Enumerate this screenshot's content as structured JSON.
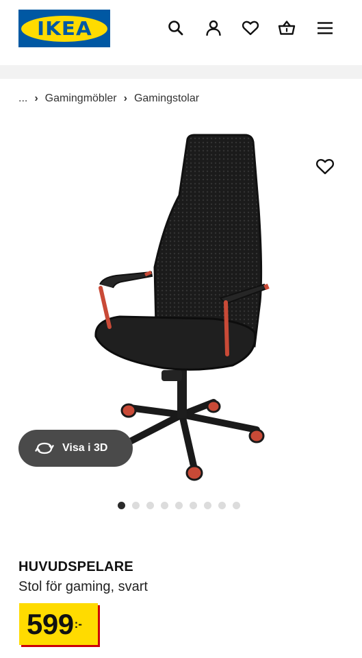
{
  "header": {
    "logo_text": "IKEA",
    "icons": [
      "search-icon",
      "account-icon",
      "heart-icon",
      "basket-icon",
      "menu-icon"
    ]
  },
  "breadcrumb": {
    "ellipsis": "...",
    "items": [
      "Gamingmöbler",
      "Gamingstolar"
    ]
  },
  "gallery": {
    "view_3d_label": "Visa i 3D",
    "image_count": 9,
    "active_index": 0
  },
  "product": {
    "name": "HUVUDSPELARE",
    "description": "Stol för gaming, svart",
    "price_integer": "599",
    "price_suffix": ":-"
  },
  "colors": {
    "brand_blue": "#0058a3",
    "brand_yellow": "#ffdb00",
    "price_shadow_red": "#cc0008"
  }
}
